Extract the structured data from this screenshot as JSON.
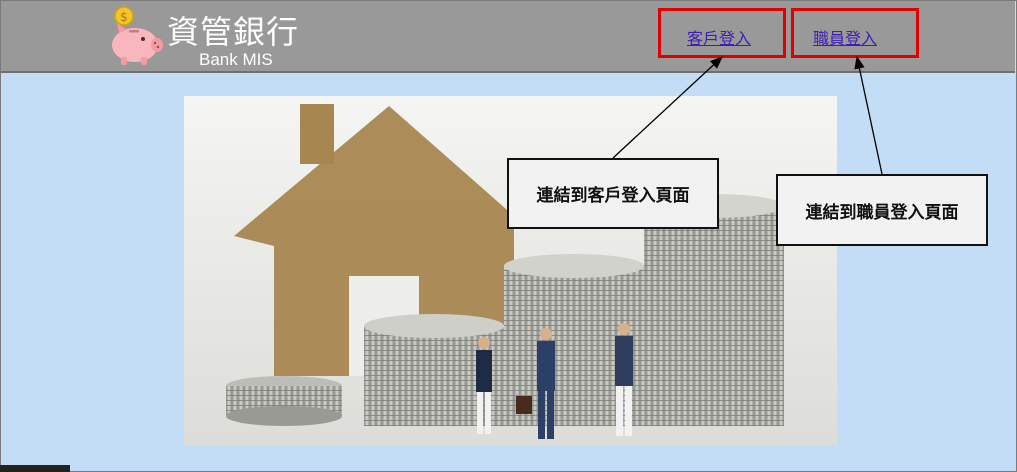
{
  "header": {
    "title": "資管銀行",
    "subtitle": "Bank MIS",
    "logo_icon": "piggy-bank-icon",
    "coin_symbol": "$"
  },
  "nav": {
    "customer_login": "客戶登入",
    "staff_login": "職員登入"
  },
  "annotations": {
    "customer_callout": "連結到客戶登入頁面",
    "staff_callout": "連結到職員登入頁面",
    "highlight_color": "#e00000"
  },
  "hero": {
    "image": "house-and-coin-stacks-with-businessmen-illustration"
  },
  "colors": {
    "header_bg": "#999999",
    "page_bg": "#c4ddf7",
    "link": "#3d1fb3"
  }
}
